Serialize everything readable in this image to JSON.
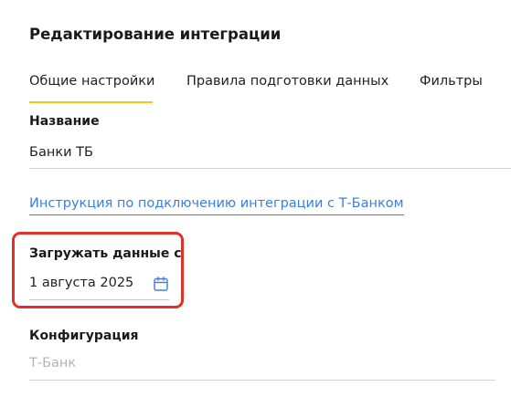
{
  "dialog": {
    "title": "Редактирование интеграции"
  },
  "tabs": [
    {
      "label": "Общие настройки",
      "active": true
    },
    {
      "label": "Правила подготовки данных",
      "active": false
    },
    {
      "label": "Фильтры",
      "active": false
    }
  ],
  "fields": {
    "name": {
      "label": "Название",
      "value": "Банки ТБ"
    },
    "instruction_link": "Инструкция по подключению интеграции с Т-Банком",
    "load_from": {
      "label": "Загружать данные с",
      "value": "1 августа 2025",
      "icon": "calendar-icon"
    },
    "configuration": {
      "label": "Конфигурация",
      "value": "Т-Банк"
    }
  },
  "colors": {
    "tab_active_underline": "#f5c518",
    "link": "#3a7ee3",
    "highlight": "#e0302a",
    "muted_text": "#b3b3b3"
  }
}
